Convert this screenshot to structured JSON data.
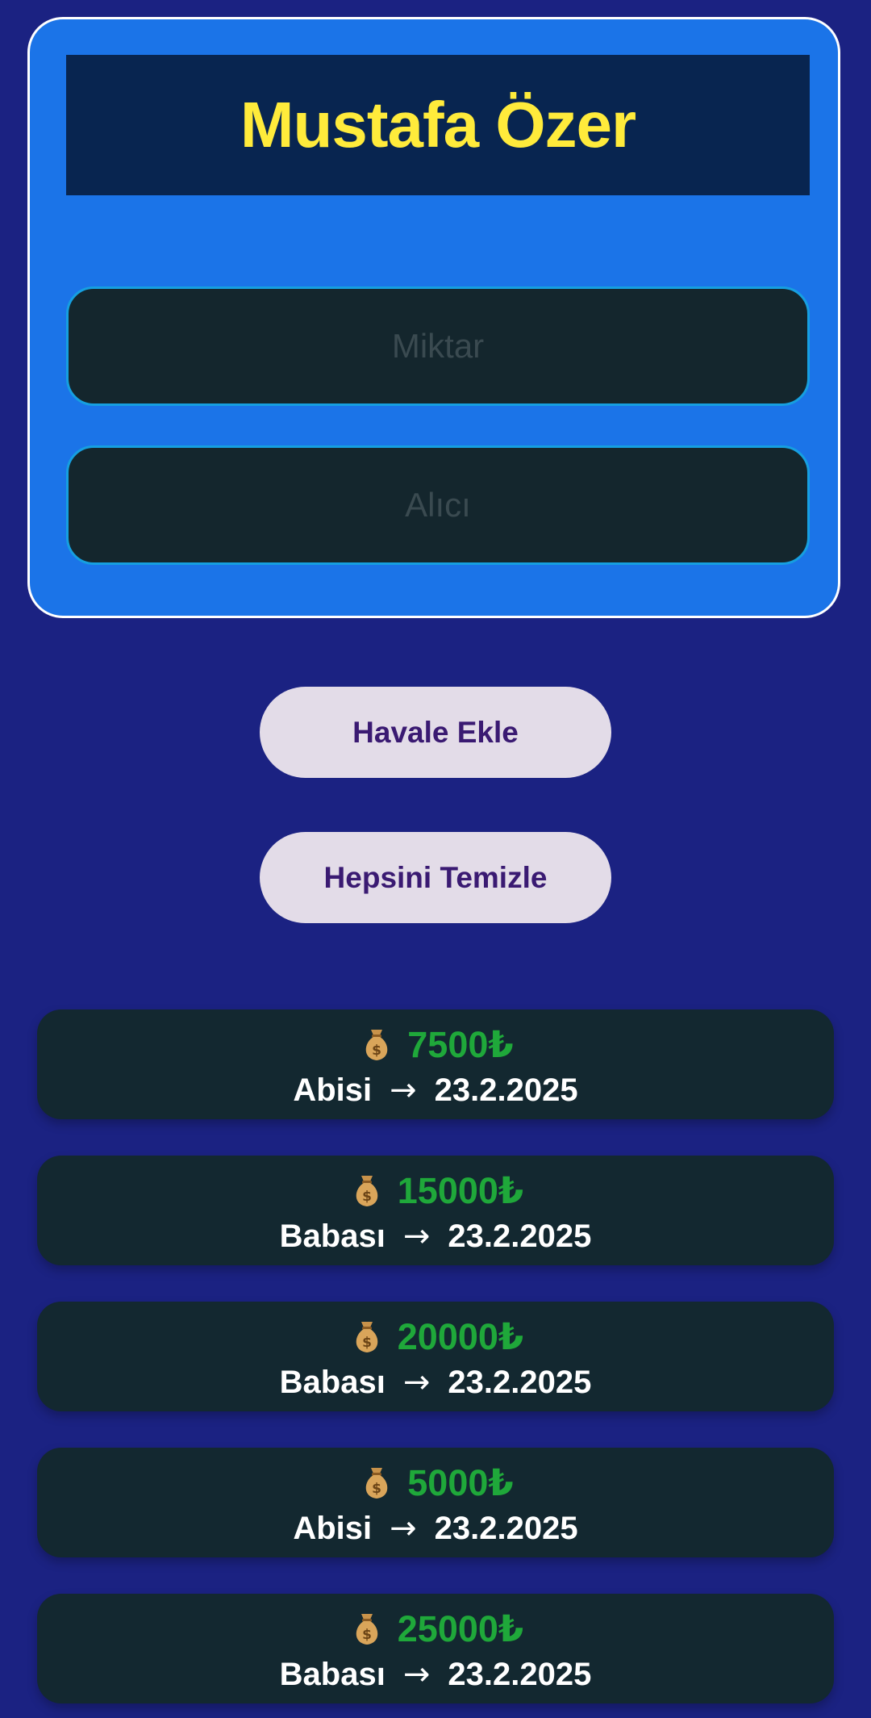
{
  "header": {
    "title": "Mustafa Özer"
  },
  "form": {
    "amount_placeholder": "Miktar",
    "recipient_placeholder": "Alıcı"
  },
  "buttons": {
    "add_label": "Havale Ekle",
    "clear_label": "Hepsini Temizle"
  },
  "transfers": [
    {
      "amount": "7500₺",
      "recipient": "Abisi",
      "arrow": "→",
      "date": "23.2.2025",
      "icon": "money-bag-icon"
    },
    {
      "amount": "15000₺",
      "recipient": "Babası",
      "arrow": "→",
      "date": "23.2.2025",
      "icon": "money-bag-icon"
    },
    {
      "amount": "20000₺",
      "recipient": "Babası",
      "arrow": "→",
      "date": "23.2.2025",
      "icon": "money-bag-icon"
    },
    {
      "amount": "5000₺",
      "recipient": "Abisi",
      "arrow": "→",
      "date": "23.2.2025",
      "icon": "money-bag-icon"
    },
    {
      "amount": "25000₺",
      "recipient": "Babası",
      "arrow": "→",
      "date": "23.2.2025",
      "icon": "money-bag-icon"
    }
  ],
  "colors": {
    "background": "#1b2282",
    "card": "#1b74e8",
    "title_box": "#082550",
    "title_text": "#ffeb3b",
    "input_bg": "#14262d",
    "input_border": "#169fe0",
    "button_bg": "#e3dce8",
    "button_text": "#3a1a72",
    "item_bg": "#132830",
    "amount_text": "#1fa83a"
  }
}
